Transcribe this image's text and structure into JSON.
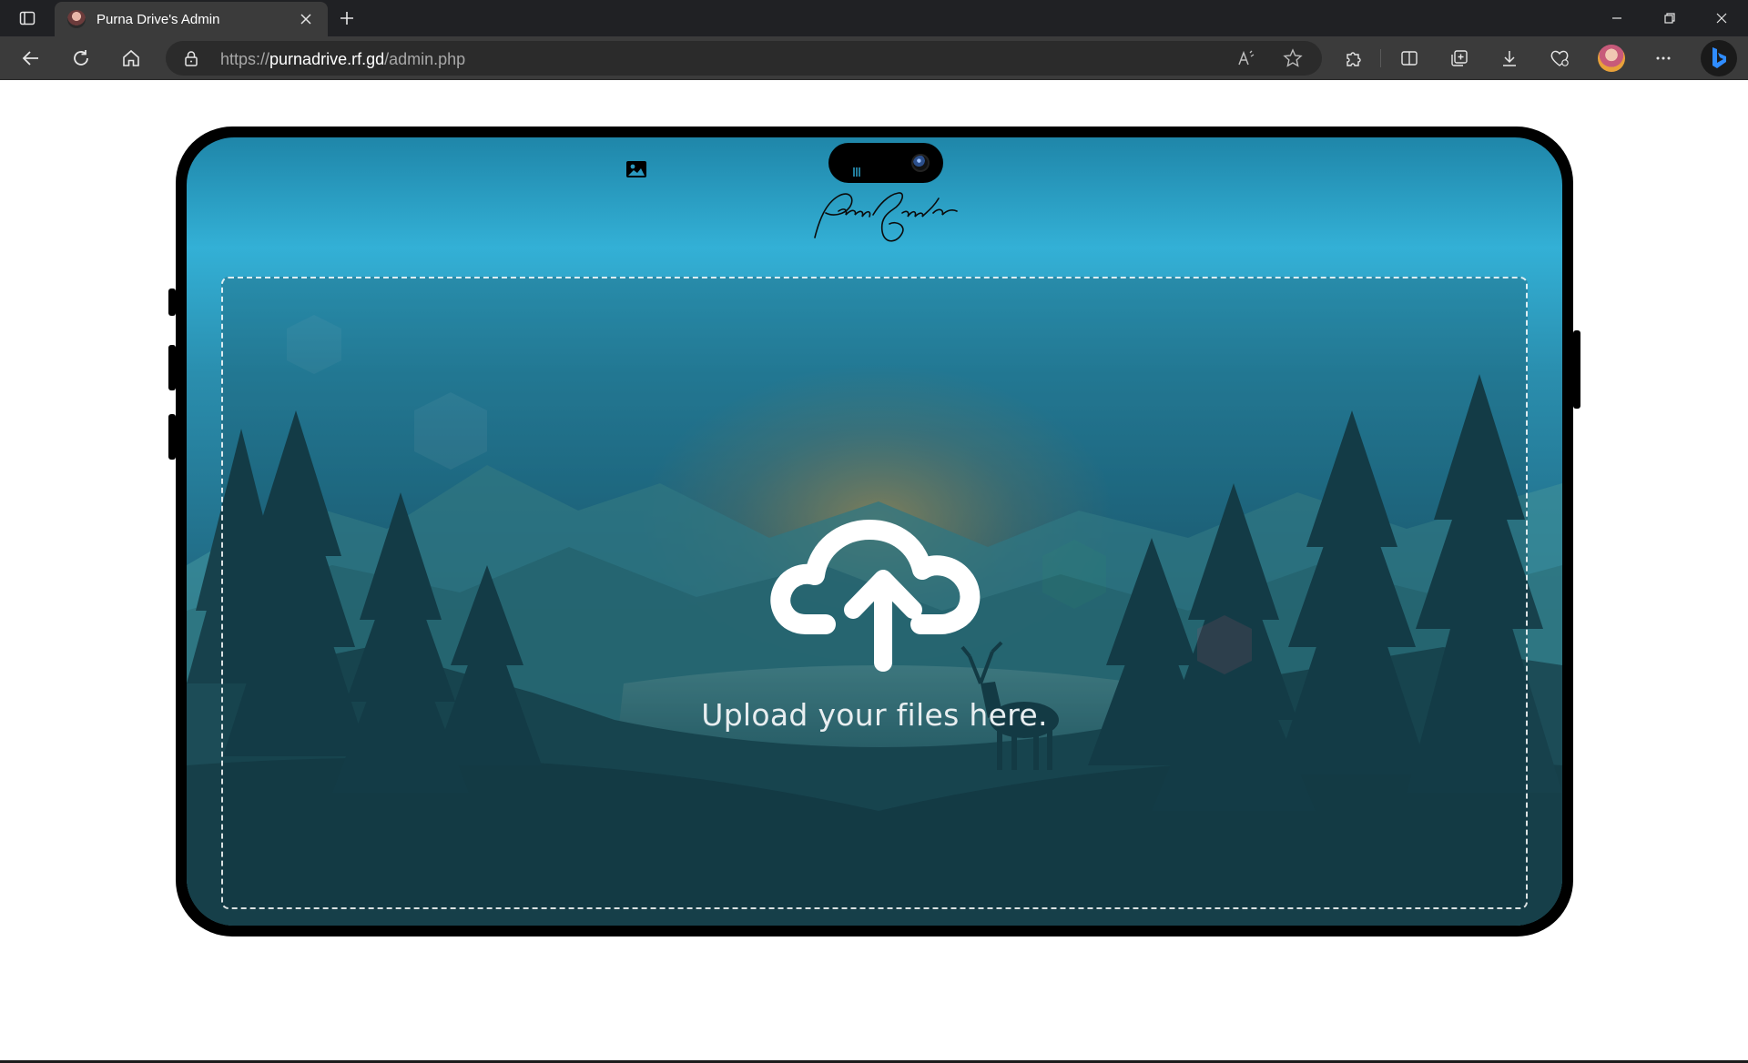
{
  "browser": {
    "tab_title": "Purna Drive's Admin",
    "url_prefix": "https://",
    "url_host": "purnadrive.rf.gd",
    "url_path": "/admin.php"
  },
  "app": {
    "upload_message": "Upload your files here."
  },
  "colors": {
    "chrome_dark": "#202124",
    "toolbar": "#3b3b3b",
    "accent_bing": "#1f6fe0"
  }
}
